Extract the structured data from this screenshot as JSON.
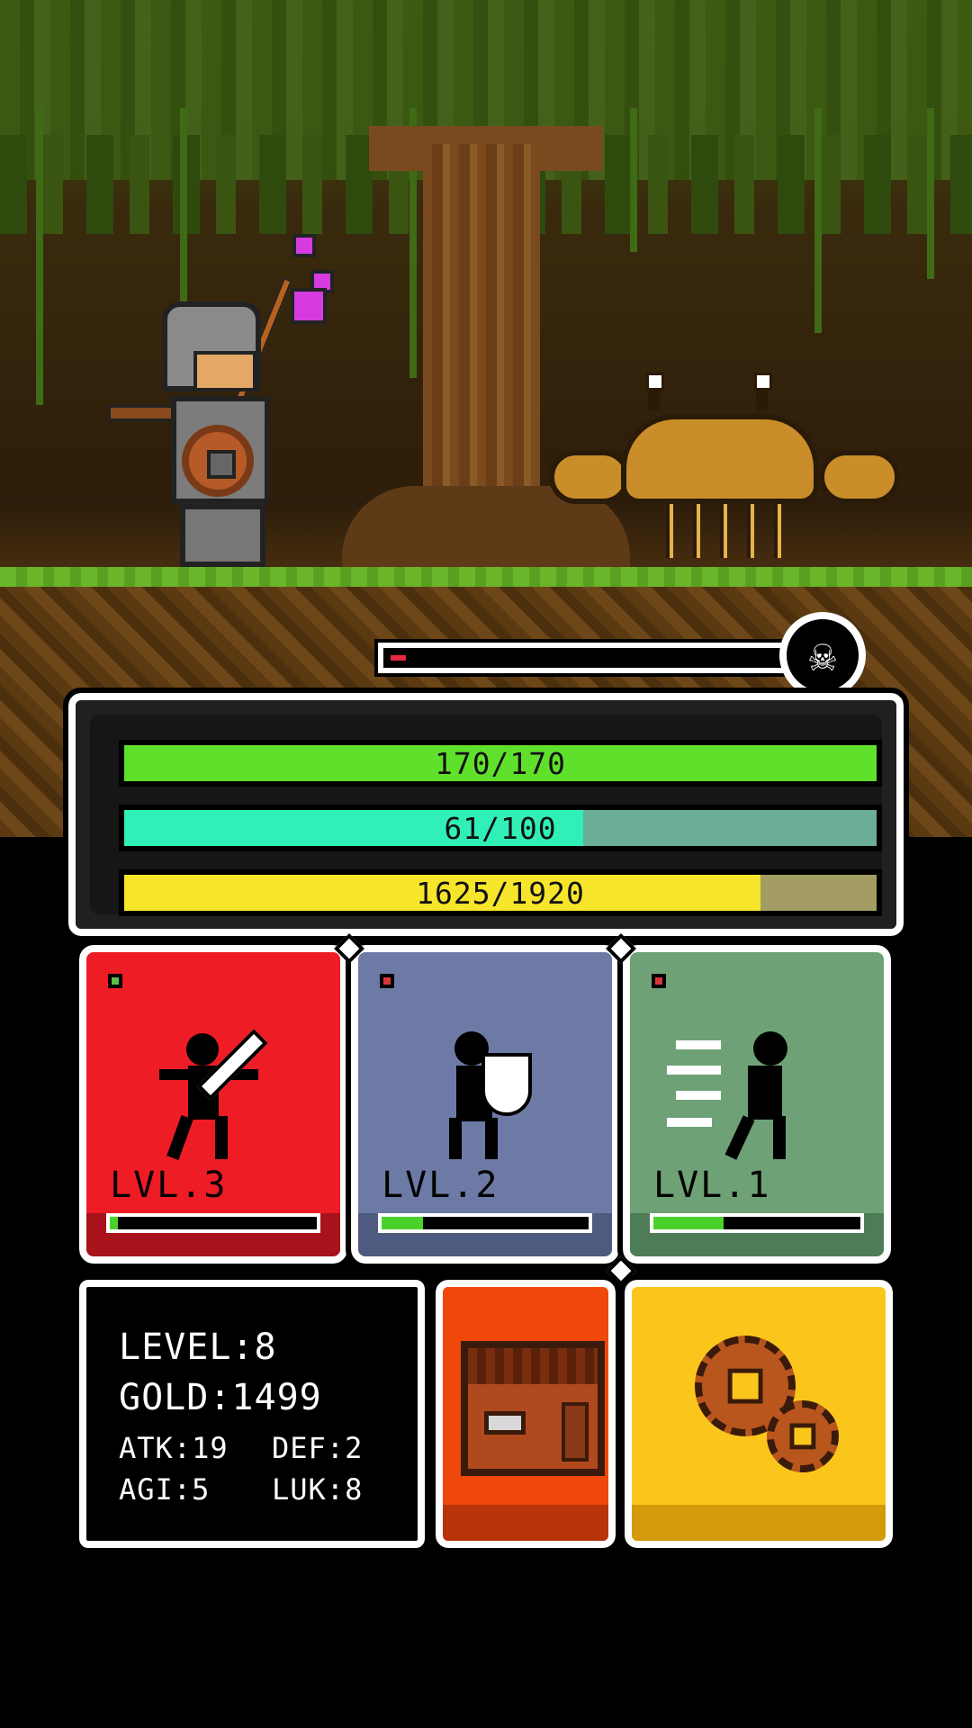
{
  "enemy": {
    "hp_fraction": 0.04,
    "icon": "skull-icon"
  },
  "player_bars": {
    "hp": {
      "text": "170/170",
      "fraction": 1.0
    },
    "mp": {
      "text": "61/100",
      "fraction": 0.61
    },
    "xp": {
      "text": "1625/1920",
      "fraction": 0.846
    }
  },
  "skills": [
    {
      "id": "attack",
      "label": "LVL.3",
      "progress": 0.04,
      "icon": "attack-sword-icon"
    },
    {
      "id": "defense",
      "label": "LVL.2",
      "progress": 0.2,
      "icon": "defense-shield-icon"
    },
    {
      "id": "agility",
      "label": "LVL.1",
      "progress": 0.34,
      "icon": "agility-dash-icon"
    }
  ],
  "stats": {
    "level": "LEVEL:8",
    "gold": "GOLD:1499",
    "atk": "ATK:19",
    "def": "DEF:2",
    "agi": "AGI:5",
    "luk": "LUK:8"
  },
  "buttons": {
    "shop_icon": "treasure-chest-icon",
    "settings_icon": "gears-icon"
  },
  "colors": {
    "hp": "#5fe12c",
    "mp": "#30f0b8",
    "xp": "#f6e52a",
    "attack_card": "#ee1c25",
    "defense_card": "#6d7aa6",
    "agility_card": "#6ea276",
    "shop_button": "#f0480a",
    "settings_button": "#fbc61c"
  }
}
